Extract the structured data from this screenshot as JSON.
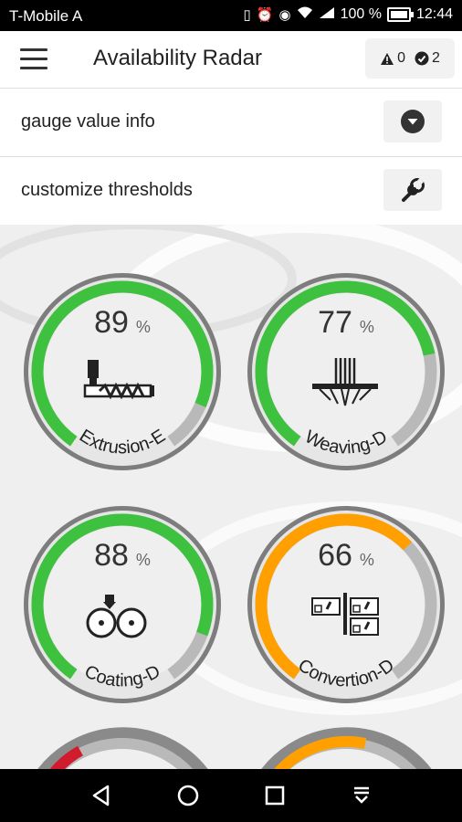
{
  "status": {
    "carrier": "T-Mobile A",
    "battery": "100 %",
    "time": "12:44"
  },
  "appbar": {
    "title": "Availability Radar",
    "warnings": "0",
    "checks": "2"
  },
  "rows": [
    {
      "label": "gauge value info",
      "icon": "chevron-down-icon"
    },
    {
      "label": "customize thresholds",
      "icon": "wrench-icon"
    }
  ],
  "gauges": [
    {
      "name": "Extrusion-E",
      "value": "89",
      "unit": "%",
      "level": 0.89,
      "status": "ok",
      "icon": "extrusion-icon"
    },
    {
      "name": "Weaving-D",
      "value": "77",
      "unit": "%",
      "level": 0.77,
      "status": "ok",
      "icon": "weaving-icon"
    },
    {
      "name": "Coating-D",
      "value": "88",
      "unit": "%",
      "level": 0.88,
      "status": "ok",
      "icon": "coating-icon"
    },
    {
      "name": "Convertion-D",
      "value": "66",
      "unit": "%",
      "level": 0.66,
      "status": "warn",
      "icon": "convertion-icon"
    }
  ],
  "colors": {
    "ok": "#3ec13e",
    "warn": "#ffa000",
    "alarm": "#d01c2c",
    "track": "#b9b9b9"
  },
  "navbar": [
    "back-icon",
    "home-icon",
    "recents-icon",
    "notifications-icon"
  ]
}
